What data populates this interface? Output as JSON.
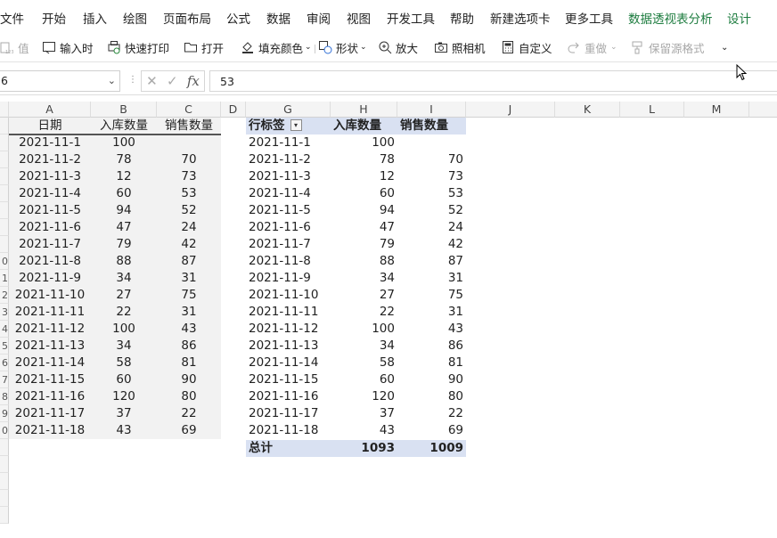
{
  "menu": {
    "items": [
      "文件",
      "开始",
      "插入",
      "绘图",
      "页面布局",
      "公式",
      "数据",
      "审阅",
      "视图",
      "开发工具",
      "帮助",
      "新建选项卡",
      "更多工具"
    ],
    "accent_items": [
      "数据透视表分析",
      "设计"
    ],
    "accent_color": "#1d7c3f"
  },
  "toolbar": {
    "value_label": "值",
    "input_time": "输入时",
    "quick_print": "快速打印",
    "open": "打开",
    "fill_color": "填充颜色",
    "shapes": "形状",
    "zoom_in": "放大",
    "camera": "照相机",
    "customize": "自定义",
    "redo": "重做",
    "keep_format": "保留源格式"
  },
  "formula": {
    "name_box": "6",
    "value": "53",
    "fx": "fx"
  },
  "columns": [
    "A",
    "B",
    "C",
    "D",
    "G",
    "H",
    "I",
    "J",
    "K",
    "L",
    "M"
  ],
  "rows": [
    "",
    "",
    "",
    "",
    "",
    "",
    "",
    "",
    "0",
    "1",
    "2",
    "3",
    "4",
    "5",
    "6",
    "7",
    "8",
    "9",
    "0",
    "",
    "",
    "",
    "",
    ""
  ],
  "source": {
    "headers": [
      "日期",
      "入库数量",
      "销售数量"
    ],
    "rows": [
      [
        "2021-11-1",
        "100",
        ""
      ],
      [
        "2021-11-2",
        "78",
        "70"
      ],
      [
        "2021-11-3",
        "12",
        "73"
      ],
      [
        "2021-11-4",
        "60",
        "53"
      ],
      [
        "2021-11-5",
        "94",
        "52"
      ],
      [
        "2021-11-6",
        "47",
        "24"
      ],
      [
        "2021-11-7",
        "79",
        "42"
      ],
      [
        "2021-11-8",
        "88",
        "87"
      ],
      [
        "2021-11-9",
        "34",
        "31"
      ],
      [
        "2021-11-10",
        "27",
        "75"
      ],
      [
        "2021-11-11",
        "22",
        "31"
      ],
      [
        "2021-11-12",
        "100",
        "43"
      ],
      [
        "2021-11-13",
        "34",
        "86"
      ],
      [
        "2021-11-14",
        "58",
        "81"
      ],
      [
        "2021-11-15",
        "60",
        "90"
      ],
      [
        "2021-11-16",
        "120",
        "80"
      ],
      [
        "2021-11-17",
        "37",
        "22"
      ],
      [
        "2021-11-18",
        "43",
        "69"
      ]
    ]
  },
  "pivot": {
    "headers": [
      "行标签",
      "入库数量",
      "销售数量"
    ],
    "rows": [
      [
        "2021-11-1",
        "100",
        ""
      ],
      [
        "2021-11-2",
        "78",
        "70"
      ],
      [
        "2021-11-3",
        "12",
        "73"
      ],
      [
        "2021-11-4",
        "60",
        "53"
      ],
      [
        "2021-11-5",
        "94",
        "52"
      ],
      [
        "2021-11-6",
        "47",
        "24"
      ],
      [
        "2021-11-7",
        "79",
        "42"
      ],
      [
        "2021-11-8",
        "88",
        "87"
      ],
      [
        "2021-11-9",
        "34",
        "31"
      ],
      [
        "2021-11-10",
        "27",
        "75"
      ],
      [
        "2021-11-11",
        "22",
        "31"
      ],
      [
        "2021-11-12",
        "100",
        "43"
      ],
      [
        "2021-11-13",
        "34",
        "86"
      ],
      [
        "2021-11-14",
        "58",
        "81"
      ],
      [
        "2021-11-15",
        "60",
        "90"
      ],
      [
        "2021-11-16",
        "120",
        "80"
      ],
      [
        "2021-11-17",
        "37",
        "22"
      ],
      [
        "2021-11-18",
        "43",
        "69"
      ]
    ],
    "total": [
      "总计",
      "1093",
      "1009"
    ],
    "header_color": "#d9e1f2"
  }
}
